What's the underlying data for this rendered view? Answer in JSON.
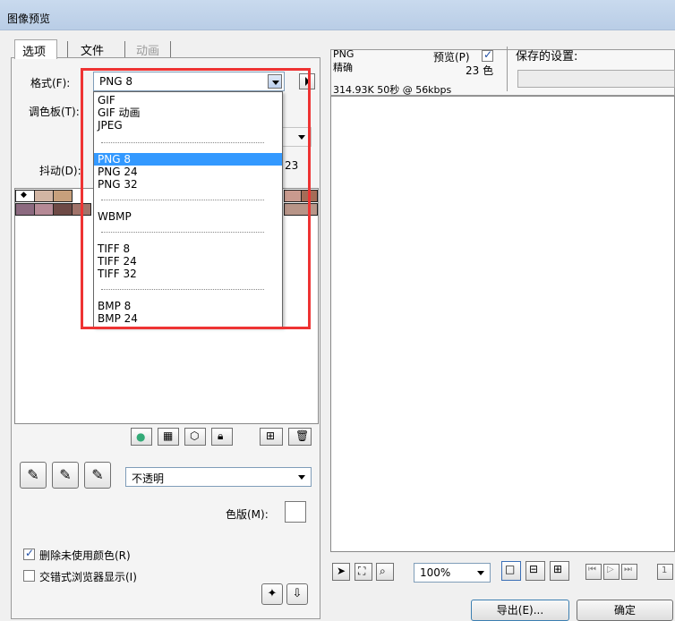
{
  "window": {
    "title": "图像预览"
  },
  "tabs": [
    {
      "label": "选项"
    },
    {
      "label": "文件"
    },
    {
      "label": "动画"
    }
  ],
  "format": {
    "label": "格式(F):",
    "value": "PNG 8"
  },
  "palette": {
    "label": "调色板(T):"
  },
  "dither": {
    "label": "抖动(D):",
    "value": "23"
  },
  "dropdown": {
    "items": [
      {
        "label": "GIF"
      },
      {
        "label": "GIF 动画"
      },
      {
        "label": "JPEG"
      },
      {
        "label": "PNG 8"
      },
      {
        "label": "PNG 24"
      },
      {
        "label": "PNG 32"
      },
      {
        "label": "WBMP"
      },
      {
        "label": "TIFF 8"
      },
      {
        "label": "TIFF 24"
      },
      {
        "label": "TIFF 32"
      },
      {
        "label": "BMP 8"
      },
      {
        "label": "BMP 24"
      }
    ],
    "selected": "PNG 8"
  },
  "opacity": {
    "value": "不透明"
  },
  "matte": {
    "label": "色版(M):"
  },
  "options": [
    {
      "label": "删除未使用颜色(R)",
      "checked": true
    },
    {
      "label": "交错式浏览器显示(I)",
      "checked": false
    }
  ],
  "preview_info": {
    "format": "PNG",
    "quality": "精确",
    "stats": "314.93K 50秒 @ 56kbps",
    "preview_label": "预览(P)",
    "colors": "23 色"
  },
  "saved_settings": {
    "label": "保存的设置:"
  },
  "zoom": {
    "value": "100%"
  },
  "frame_start": "1",
  "buttons": {
    "export": "导出(E)...",
    "ok": "确定"
  },
  "colors": {
    "accent": "#3399ff",
    "highlight_box": "#e33333",
    "palette": [
      "#ffffff",
      "#8c6a80",
      "#b68a96",
      "#b3848d",
      "#6e4a46",
      "#a1736a",
      "#d2b5a3",
      "#c7a07c",
      "#b89588",
      "#9f7460",
      "#c99a8e",
      "#a56c57"
    ]
  }
}
